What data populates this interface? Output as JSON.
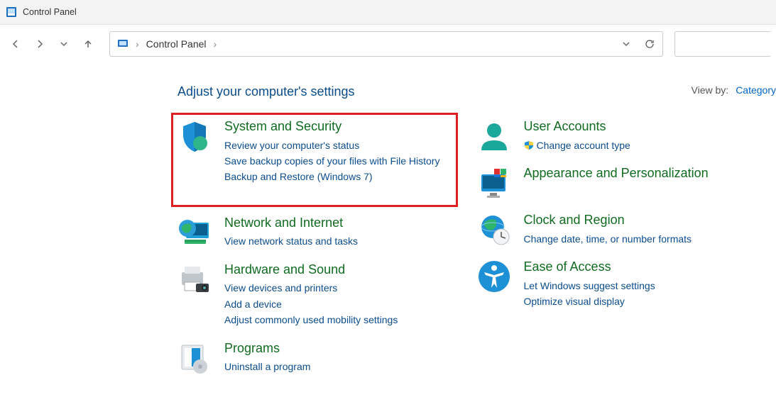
{
  "window": {
    "title": "Control Panel"
  },
  "breadcrumb": {
    "root": "Control Panel"
  },
  "page": {
    "heading": "Adjust your computer's settings",
    "view_by_label": "View by:",
    "view_by_value": "Category"
  },
  "categories": {
    "system_security": {
      "title": "System and Security",
      "links": [
        "Review your computer's status",
        "Save backup copies of your files with File History",
        "Backup and Restore (Windows 7)"
      ]
    },
    "network": {
      "title": "Network and Internet",
      "links": [
        "View network status and tasks"
      ]
    },
    "hardware": {
      "title": "Hardware and Sound",
      "links": [
        "View devices and printers",
        "Add a device",
        "Adjust commonly used mobility settings"
      ]
    },
    "programs": {
      "title": "Programs",
      "links": [
        "Uninstall a program"
      ]
    },
    "user_accounts": {
      "title": "User Accounts",
      "links": [
        "Change account type"
      ]
    },
    "appearance": {
      "title": "Appearance and Personalization",
      "links": []
    },
    "clock": {
      "title": "Clock and Region",
      "links": [
        "Change date, time, or number formats"
      ]
    },
    "ease": {
      "title": "Ease of Access",
      "links": [
        "Let Windows suggest settings",
        "Optimize visual display"
      ]
    }
  }
}
